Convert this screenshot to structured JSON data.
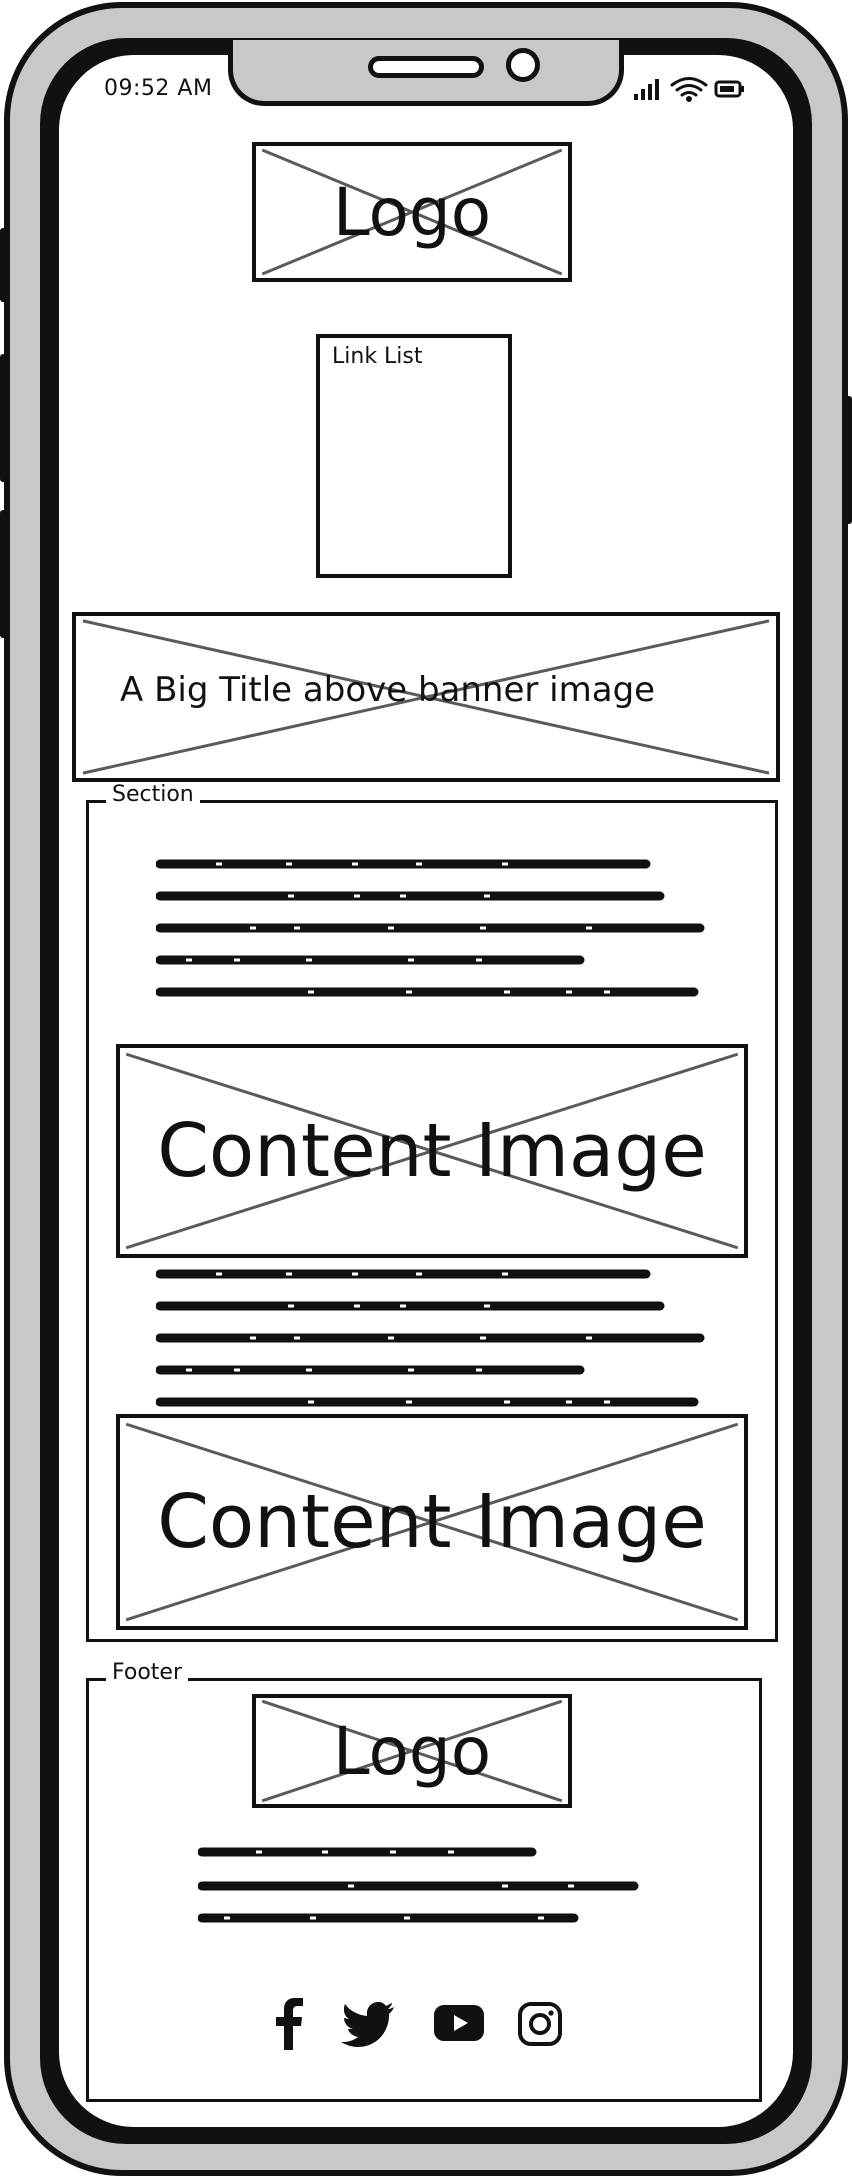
{
  "status_bar": {
    "time": "09:52 AM",
    "icons": [
      "signal-icon",
      "wifi-icon",
      "battery-icon"
    ]
  },
  "header": {
    "logo_label": "Logo",
    "link_list_label": "Link List"
  },
  "banner": {
    "title": "A Big Title above banner image"
  },
  "section": {
    "legend": "Section",
    "content_images": [
      {
        "label": "Content Image"
      },
      {
        "label": "Content Image"
      }
    ]
  },
  "footer": {
    "legend": "Footer",
    "logo_label": "Logo",
    "social_icons": [
      "facebook-icon",
      "twitter-icon",
      "youtube-icon",
      "instagram-icon"
    ]
  },
  "colors": {
    "frame": "#c8c8c8",
    "ink": "#111111",
    "cross": "#5a5a5a",
    "screen": "#ffffff"
  }
}
